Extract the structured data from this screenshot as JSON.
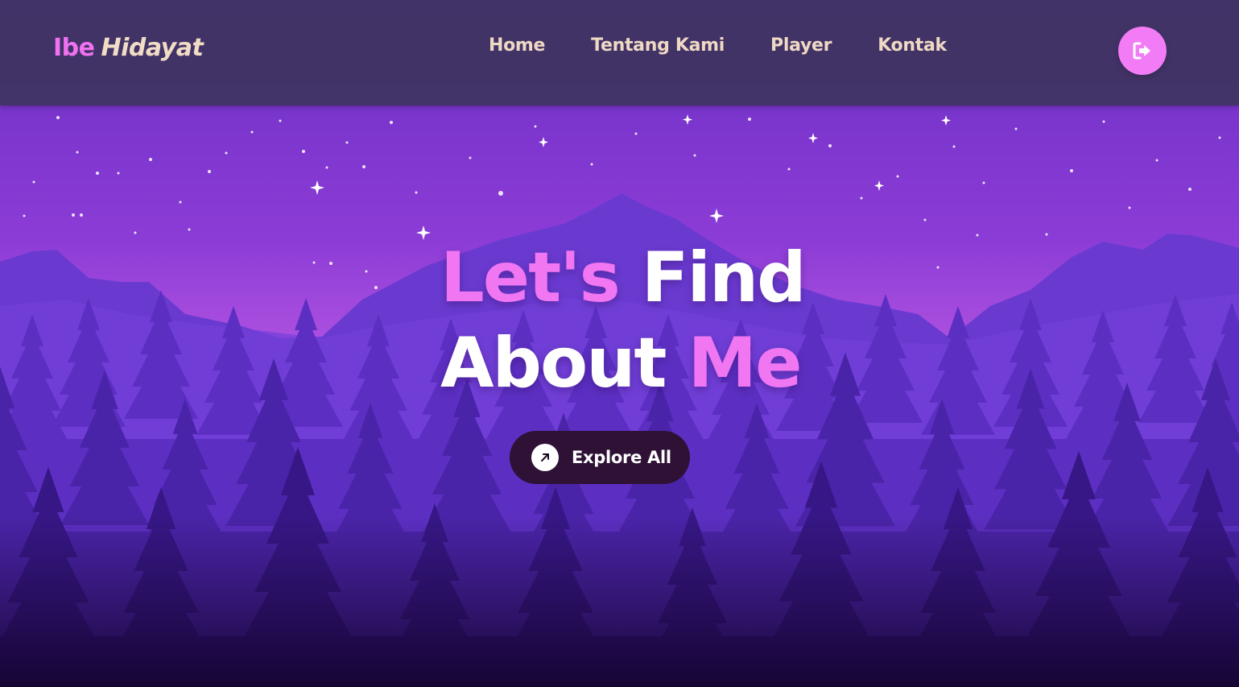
{
  "brand": {
    "first": "Ibe",
    "last": "Hidayat"
  },
  "nav": {
    "items": [
      {
        "label": "Home"
      },
      {
        "label": "Tentang Kami"
      },
      {
        "label": "Player"
      },
      {
        "label": "Kontak"
      }
    ],
    "logout_icon": "sign-out-icon"
  },
  "hero": {
    "line1_pink": "Let's",
    "line1_white": "Find",
    "line2_white": "About",
    "line2_pink": "Me",
    "button_label": "Explore All",
    "button_icon": "arrow-up-right-icon"
  },
  "colors": {
    "accent_pink": "#f076f2",
    "brand_beige": "#f1dcc6",
    "navbar_bg": "#3e3460",
    "button_dark": "#2f1136"
  }
}
